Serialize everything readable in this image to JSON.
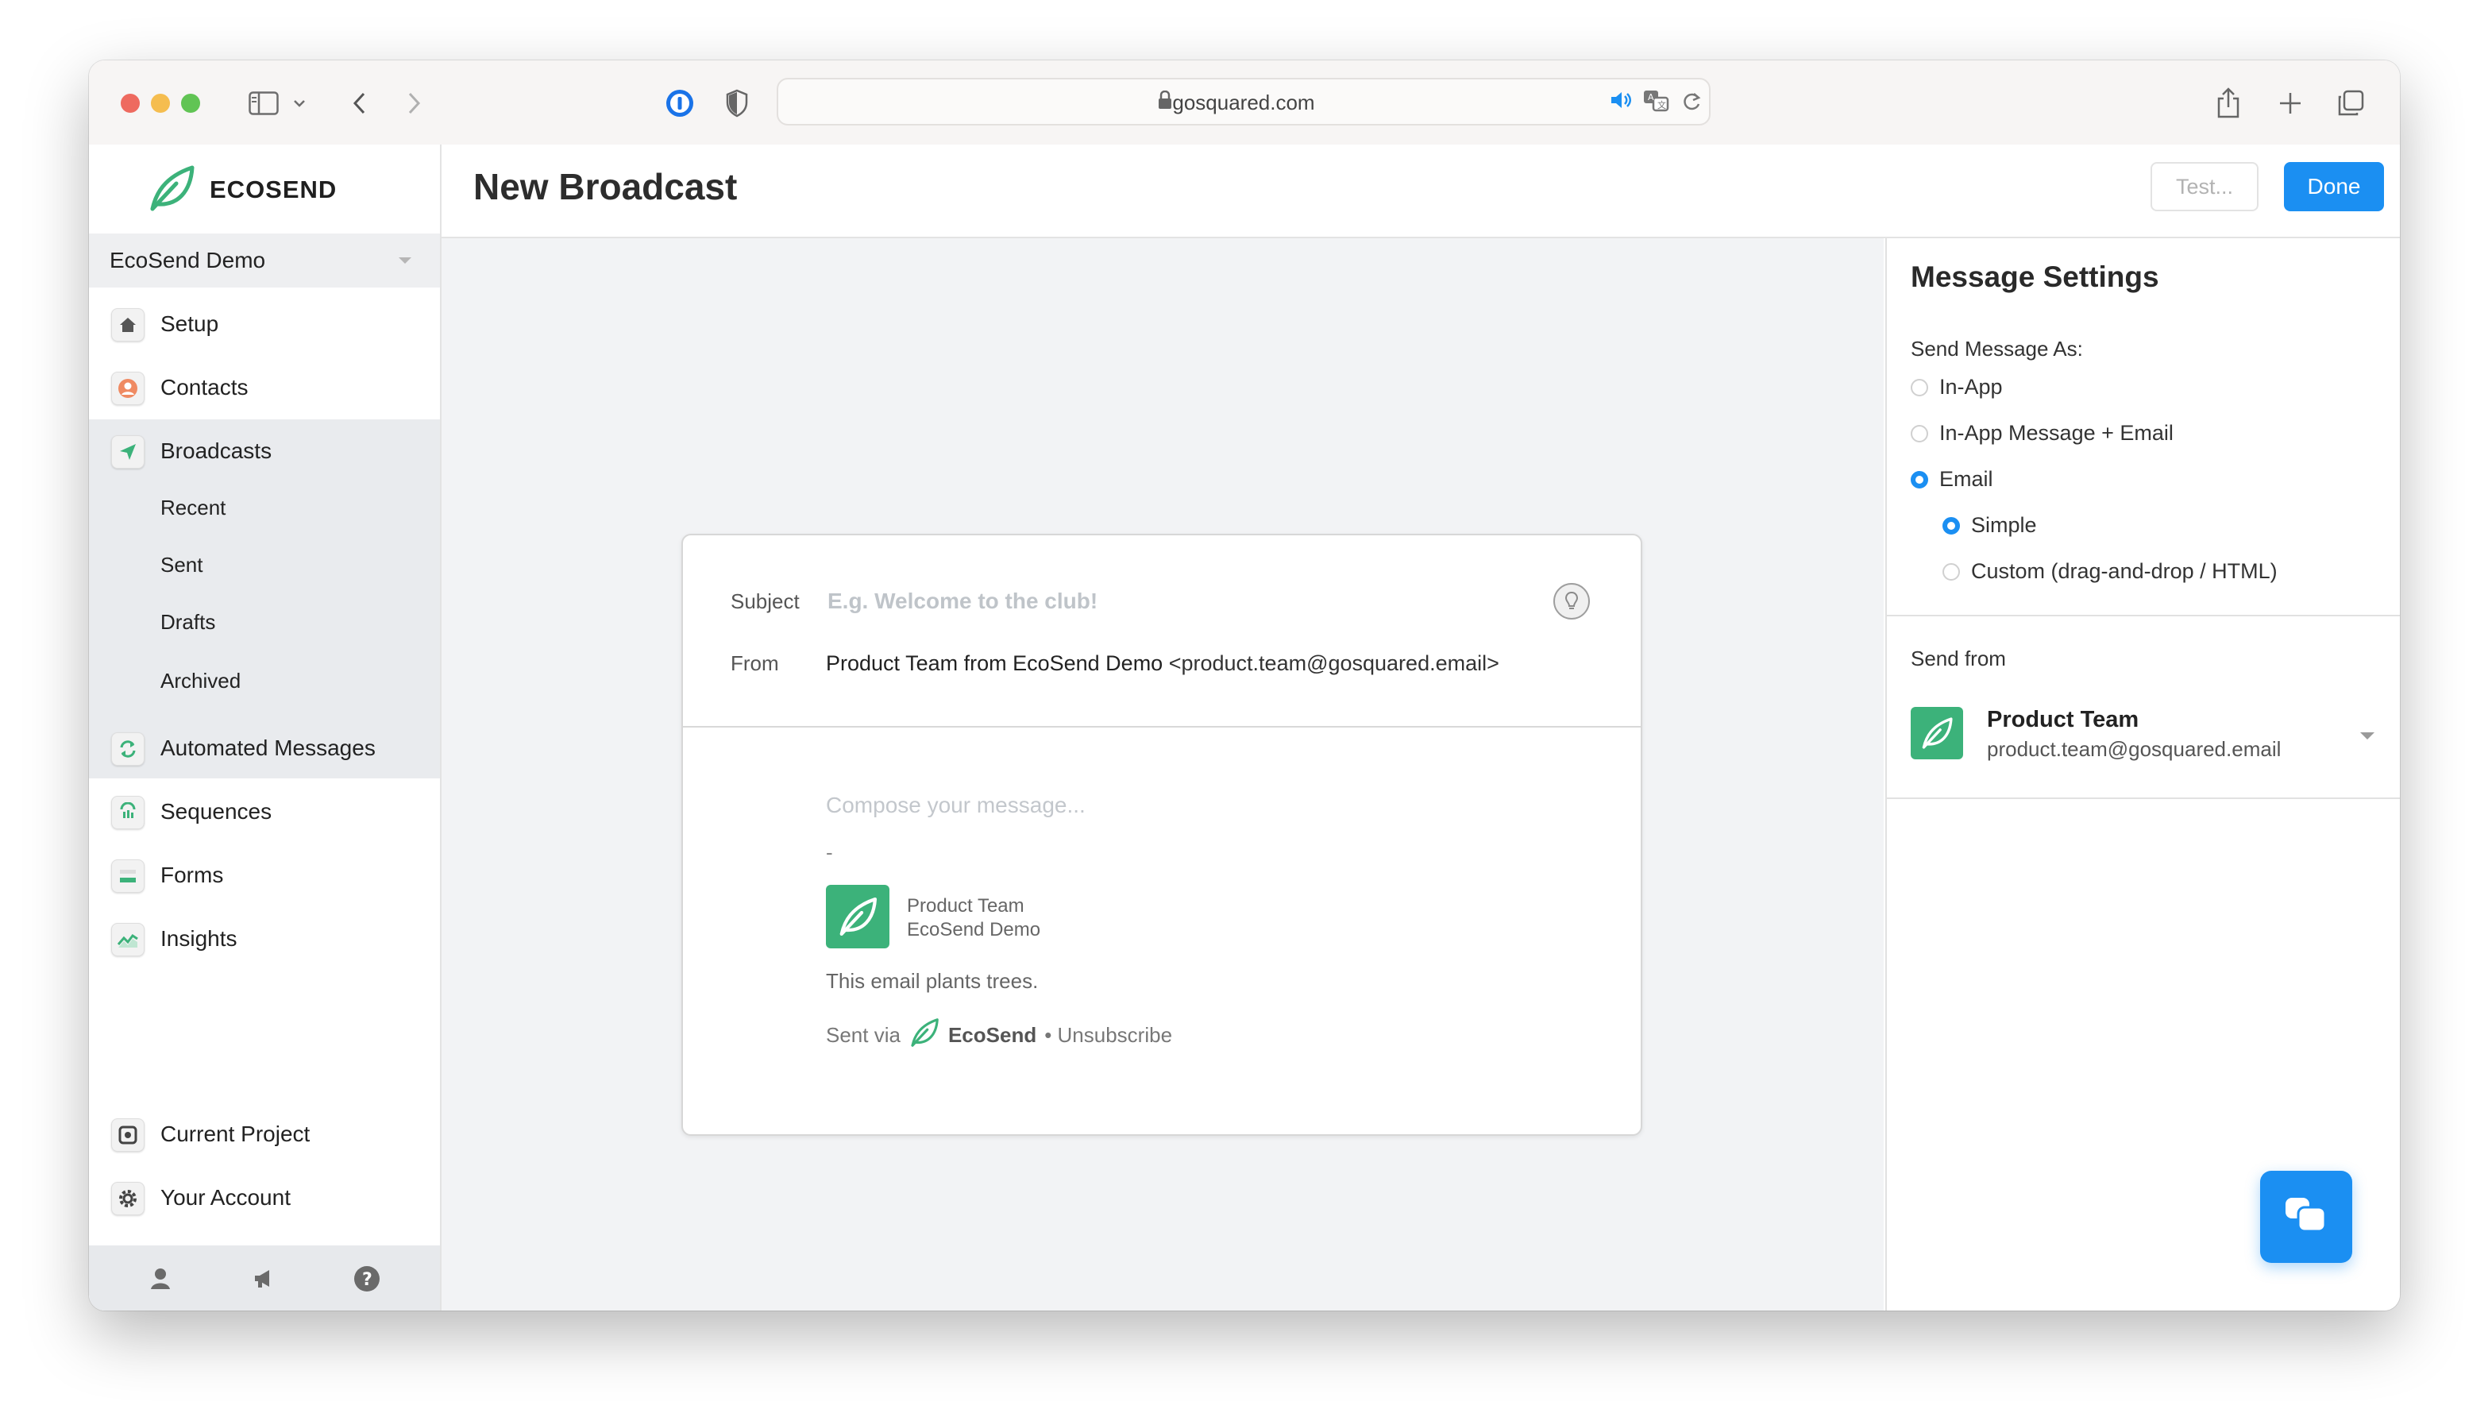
{
  "browser": {
    "url": "gosquared.com",
    "icons": [
      "sidebar-toggle-icon",
      "chevron-down-icon",
      "back-icon",
      "forward-icon",
      "password-manager-icon",
      "shield-icon",
      "lock-icon",
      "speaker-icon",
      "translate-icon",
      "reload-icon",
      "share-icon",
      "new-tab-icon",
      "tabs-overview-icon"
    ]
  },
  "brand": {
    "name": "ECOSEND",
    "color": "#3cb27a"
  },
  "project_select": {
    "value": "EcoSend Demo"
  },
  "sidebar": {
    "items": [
      {
        "label": "Setup",
        "icon": "home-icon"
      },
      {
        "label": "Contacts",
        "icon": "contact-icon"
      },
      {
        "label": "Broadcasts",
        "icon": "paper-plane-icon",
        "active": true
      },
      {
        "label": "Automated Messages",
        "icon": "refresh-icon"
      },
      {
        "label": "Sequences",
        "icon": "sequence-icon"
      },
      {
        "label": "Forms",
        "icon": "form-icon"
      },
      {
        "label": "Insights",
        "icon": "chart-icon"
      }
    ],
    "broadcast_sub": [
      "Recent",
      "Sent",
      "Drafts",
      "Archived"
    ],
    "bottom_items": [
      {
        "label": "Current Project",
        "icon": "project-icon"
      },
      {
        "label": "Your Account",
        "icon": "account-gear-icon"
      }
    ],
    "footer_icons": [
      "user-icon",
      "megaphone-icon",
      "help-icon"
    ]
  },
  "header": {
    "title": "New Broadcast",
    "test_label": "Test...",
    "done_label": "Done",
    "accent": "#1b8ff2"
  },
  "editor": {
    "subject_label": "Subject",
    "subject_placeholder": "E.g. Welcome to the club!",
    "from_label": "From",
    "from_name": "Product Team from EcoSend Demo",
    "from_address": "<product.team@gosquared.email>",
    "compose_placeholder": "Compose your message...",
    "separator": "-",
    "signature_name": "Product Team",
    "signature_project": "EcoSend Demo",
    "plant_line": "This email plants trees.",
    "sent_via": "Sent via",
    "sent_via_brand": "EcoSend",
    "unsubscribe": "• Unsubscribe"
  },
  "settings": {
    "title": "Message Settings",
    "send_as_label": "Send Message As:",
    "options": [
      {
        "label": "In-App",
        "selected": false
      },
      {
        "label": "In-App Message + Email",
        "selected": false
      },
      {
        "label": "Email",
        "selected": true
      }
    ],
    "email_types": [
      {
        "label": "Simple",
        "selected": true
      },
      {
        "label": "Custom (drag-and-drop / HTML)",
        "selected": false
      }
    ],
    "send_from_label": "Send from",
    "sender_name": "Product Team",
    "sender_email": "product.team@gosquared.email"
  },
  "chat_widget": {
    "icon": "chat-bubbles-icon"
  }
}
